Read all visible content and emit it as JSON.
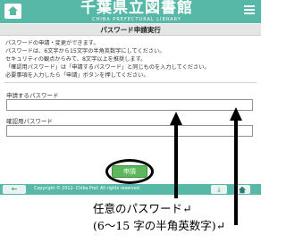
{
  "header": {
    "title": "千葉県立図書館",
    "subtitle": "CHIBA PREFECTURAL LIBRARY",
    "home_icon": "home-icon",
    "menu_icon": "menu-icon"
  },
  "page_title": "パスワード申請実行",
  "instructions": [
    "パスワードの申請・変更ができます。",
    "パスワードは、6文字から15文字の半角英数字にしてください。",
    "セキュリティの観点からみて、8文字以上を推奨します。",
    "「確認用パスワード」は「申請するパスワード」と同じものを入力してください。",
    "必要事項を入力したら「申請」ボタンを押してください。"
  ],
  "form": {
    "password_label": "申請するパスワード",
    "password_value": "",
    "confirm_label": "確認用パスワード",
    "confirm_value": ""
  },
  "submit_label": "申請",
  "footer": {
    "back_icon": "arrow-left-icon",
    "copyright": "Copyright © 2012- Chiba Pref. All rights reserved.",
    "top_icon": "arrow-down-icon",
    "home_icon": "home-icon"
  },
  "annotation": {
    "line1": "任意のパスワード↵",
    "line2": "(6～15 字の半角英数字)↵"
  }
}
